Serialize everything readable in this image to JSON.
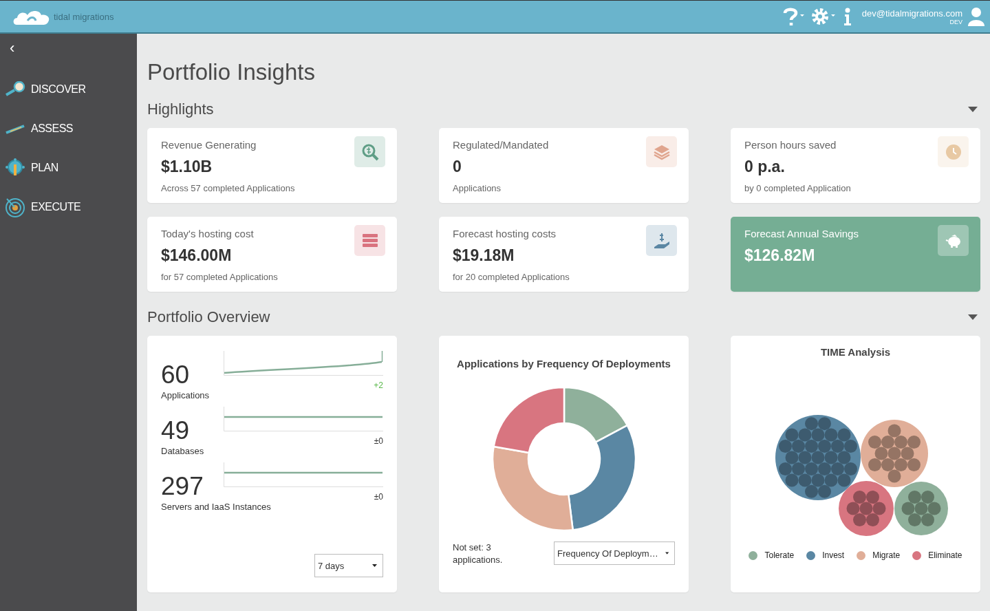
{
  "header": {
    "logo_text": "tidal migrations",
    "user_email": "dev@tidalmigrations.com",
    "user_role": "DEV"
  },
  "sidebar": {
    "collapse_glyph": "‹",
    "items": [
      {
        "label": "DISCOVER"
      },
      {
        "label": "ASSESS"
      },
      {
        "label": "PLAN"
      },
      {
        "label": "EXECUTE"
      }
    ]
  },
  "page_title": "Portfolio Insights",
  "highlights": {
    "title": "Highlights",
    "expanded": true,
    "cards": [
      {
        "kind": "plain",
        "title": "Revenue Generating",
        "value": "$1.10B",
        "note": "Across 57 completed Applications",
        "color": "#5f9e86"
      },
      {
        "kind": "plain",
        "title": "Regulated/Mandated",
        "value": "0",
        "note": "Applications",
        "color": "#e0a58e"
      },
      {
        "kind": "plain",
        "title": "Person hours saved",
        "value": "0 p.a.",
        "note": "by 0 completed Application",
        "color": "#e8c9a4"
      },
      {
        "kind": "plain",
        "title": "Today's hosting cost",
        "value": "$146.00M",
        "note": "for 57 completed Applications",
        "color": "#d9737f"
      },
      {
        "kind": "plain",
        "title": "Forecast hosting costs",
        "value": "$19.18M",
        "note": "for 20 completed Applications",
        "color": "#5b87a4"
      },
      {
        "kind": "highlight",
        "title": "Forecast Annual Savings",
        "value": "$126.82M",
        "color": "#ffffff"
      }
    ]
  },
  "overview": {
    "title": "Portfolio Overview",
    "expanded": true,
    "counts": [
      {
        "value": "60",
        "label": "Applications",
        "delta": "+2",
        "color": "#59b84a"
      },
      {
        "value": "49",
        "label": "Databases",
        "delta": "±0",
        "color": "#333333"
      },
      {
        "value": "297",
        "label": "Servers and IaaS Instances",
        "delta": "±0",
        "color": "#333333"
      }
    ],
    "period_select": {
      "value": "7 days"
    },
    "deployments": {
      "title": "Applications by Frequency Of Deployments",
      "note": "Not set: 3 applications.",
      "select_value": "Frequency Of Deploym…"
    },
    "time_analysis": {
      "title": "TIME Analysis",
      "legend": [
        {
          "label": "Tolerate",
          "color": "#8fb09b"
        },
        {
          "label": "Invest",
          "color": "#5a87a3"
        },
        {
          "label": "Migrate",
          "color": "#e0ae98"
        },
        {
          "label": "Eliminate",
          "color": "#d87580"
        }
      ]
    }
  }
}
